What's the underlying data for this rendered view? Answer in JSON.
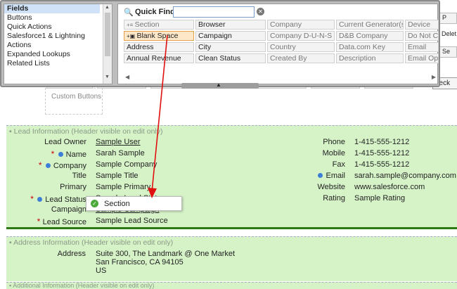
{
  "palette": {
    "categories": [
      {
        "label": "Fields",
        "selected": true
      },
      {
        "label": "Buttons"
      },
      {
        "label": "Quick Actions"
      },
      {
        "label": "Salesforce1 & Lightning"
      },
      {
        "label": "Actions"
      },
      {
        "label": "Expanded Lookups"
      },
      {
        "label": "Related Lists"
      }
    ],
    "quick_find": {
      "label": "Quick Find",
      "value": ""
    },
    "field_rows": [
      [
        "Section",
        "Browser",
        "Company",
        "Current Generator(s",
        "Device"
      ],
      [
        "Blank Space",
        "Campaign",
        "Company D-U-N-S N",
        "D&B Company",
        "Do Not C"
      ],
      [
        "Address",
        "City",
        "Country",
        "Data.com Key",
        "Email"
      ],
      [
        "Annual Revenue",
        "Clean Status",
        "Created By",
        "Description",
        "Email Op"
      ]
    ]
  },
  "background": {
    "right_buttons": [
      "P",
      "Delet",
      "Se"
    ],
    "check_label": "heck",
    "custom_buttons": "Custom Buttons"
  },
  "drag_popup": {
    "label": "Section"
  },
  "lead_section": {
    "title": "Lead Information  (Header visible on edit only)",
    "left_fields": [
      {
        "label": "Lead Owner",
        "value": "Sample User",
        "required": false,
        "dot": false,
        "link": true
      },
      {
        "label": "Name",
        "value": "Sarah Sample",
        "required": true,
        "dot": true
      },
      {
        "label": "Company",
        "value": "Sample Company",
        "required": true,
        "dot": true
      },
      {
        "label": "Title",
        "value": "Sample Title",
        "required": false,
        "dot": false
      },
      {
        "label": "Primary",
        "value": "Sample Primary",
        "required": false,
        "dot": false
      },
      {
        "label": "Lead Status",
        "value": "Sample Lead Status",
        "required": true,
        "dot": true
      },
      {
        "label": "Campaign",
        "value": "Sample Campaign",
        "required": false,
        "dot": false,
        "link": true
      },
      {
        "label": "Lead Source",
        "value": "Sample Lead Source",
        "required": true,
        "dot": false
      }
    ],
    "right_fields": [
      {
        "label": "Phone",
        "value": "1-415-555-1212",
        "dot": false
      },
      {
        "label": "Mobile",
        "value": "1-415-555-1212",
        "dot": false
      },
      {
        "label": "Fax",
        "value": "1-415-555-1212",
        "dot": false
      },
      {
        "label": "Email",
        "value": "sarah.sample@company.com",
        "dot": true
      },
      {
        "label": "Website",
        "value": "www.salesforce.com",
        "dot": false
      },
      {
        "label": "Rating",
        "value": "Sample Rating",
        "dot": false
      }
    ]
  },
  "address_section": {
    "title": "Address Information  (Header visible on edit only)",
    "label": "Address",
    "lines": [
      "Suite 300, The Landmark @ One Market",
      "San Francisco, CA 94105",
      "US"
    ]
  },
  "additional_section": {
    "title": "Additional Information  (Header visible on edit only)"
  },
  "colors": {
    "section_bg": "#d6f3c8",
    "section_border": "#2d7a13",
    "arrow": "#e01010",
    "required": "#cc0000",
    "dot": "#3d7ed6"
  }
}
